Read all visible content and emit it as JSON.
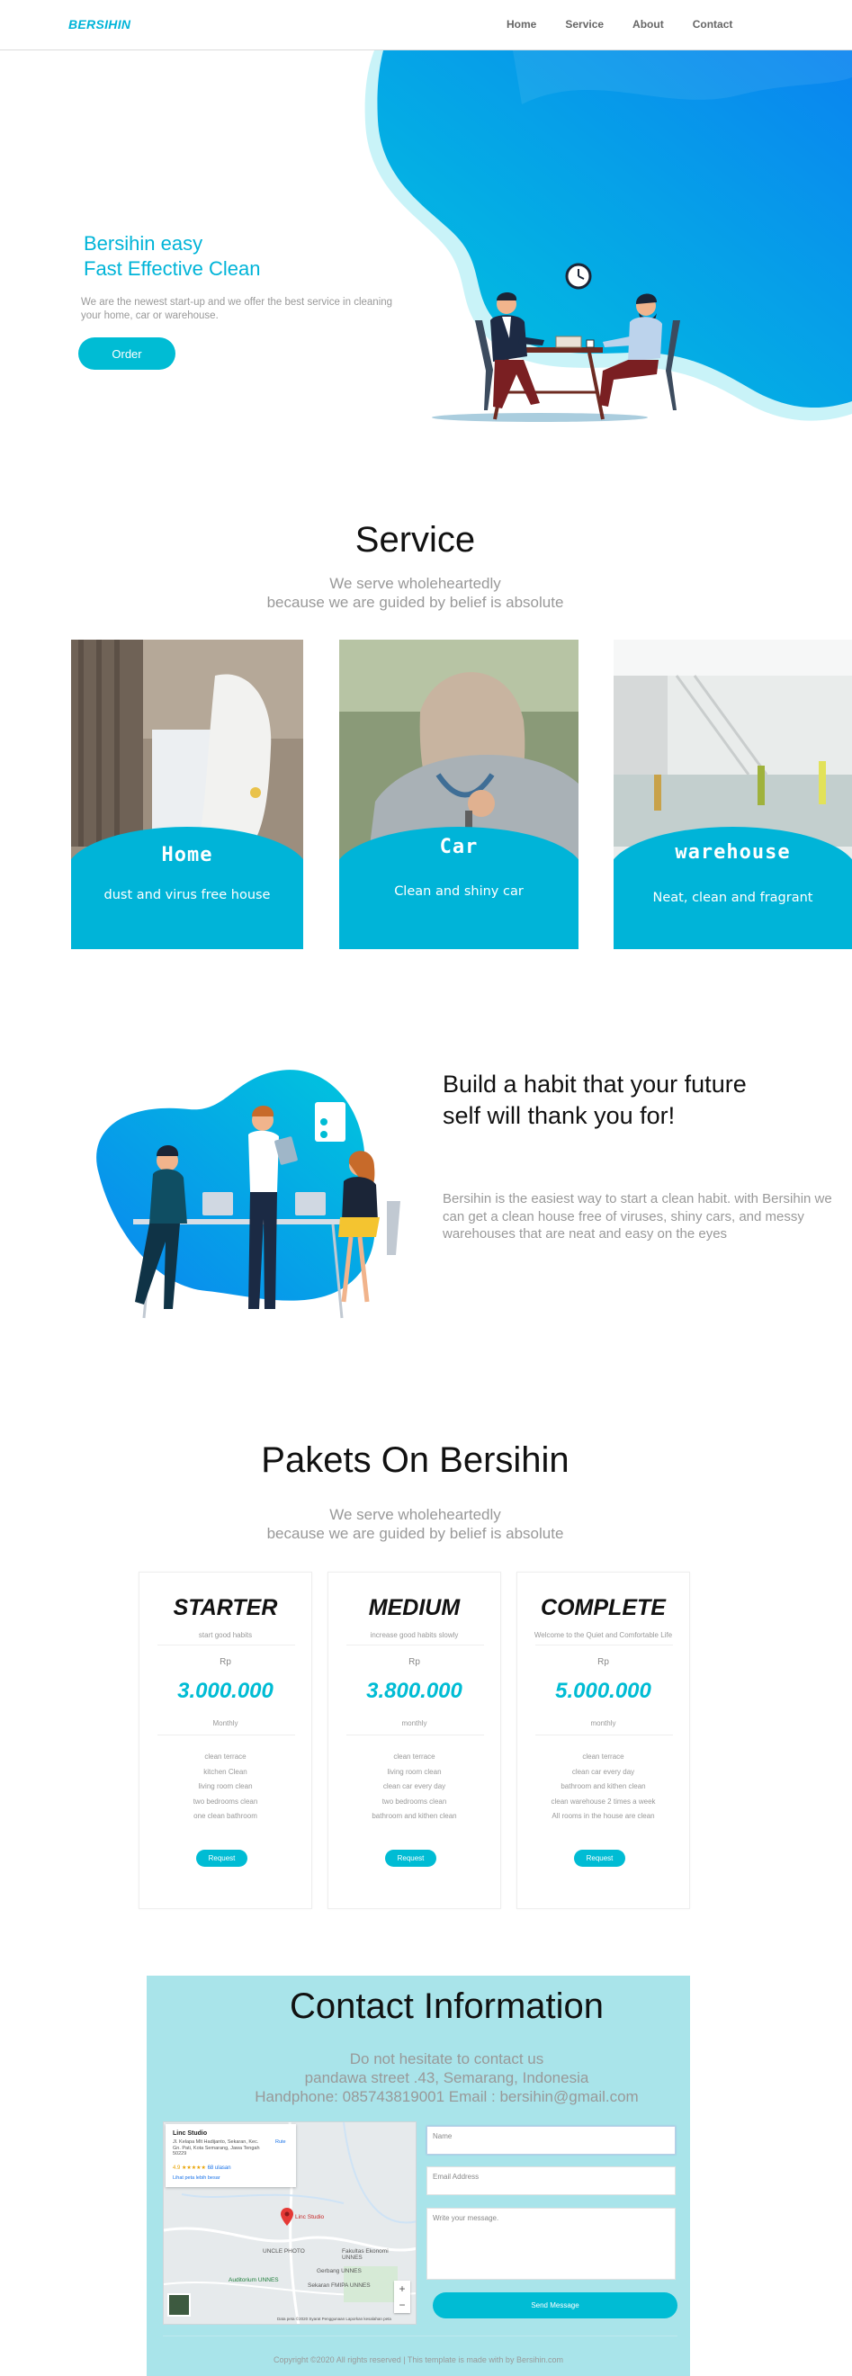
{
  "nav": {
    "brand": "BERSIHIN",
    "links": [
      "Home",
      "Service",
      "About",
      "Contact"
    ]
  },
  "hero": {
    "title_line1": "Bersihin easy",
    "title_line2": "Fast Effective Clean",
    "subtitle": "We are the newest start-up and we offer the best service in cleaning your home, car or warehouse.",
    "order_label": "Order"
  },
  "service": {
    "title": "Service",
    "sub_line1": "We serve wholeheartedly",
    "sub_line2": "because we are guided by belief is absolute",
    "cards": [
      {
        "title": "Home",
        "desc": "dust and virus free house"
      },
      {
        "title": "Car",
        "desc": "Clean and shiny car"
      },
      {
        "title": "warehouse",
        "desc": "Neat, clean and fragrant"
      }
    ]
  },
  "habit": {
    "title": "Build a habit that your future self will thank you for!",
    "text": "Bersihin is the easiest way to start a clean habit. with Bersihin we can get a clean house free of viruses, shiny cars, and messy warehouses that are neat and easy on the eyes"
  },
  "pakets": {
    "title": "Pakets On Bersihin",
    "sub_line1": "We serve wholeheartedly",
    "sub_line2": "because we are guided by belief is absolute",
    "cards": [
      {
        "name": "STARTER",
        "tag": "start good habits",
        "currency": "Rp",
        "price": "3.000.000",
        "period": "Monthly",
        "features": [
          "clean terrace",
          "kitchen Clean",
          "living room clean",
          "two bedrooms clean",
          "one clean bathroom"
        ],
        "button": "Request"
      },
      {
        "name": "MEDIUM",
        "tag": "increase good habits slowly",
        "currency": "Rp",
        "price": "3.800.000",
        "period": "monthly",
        "features": [
          "clean terrace",
          "living room clean",
          "clean car every day",
          "two bedrooms clean",
          "bathroom and kithen clean"
        ],
        "button": "Request"
      },
      {
        "name": "COMPLETE",
        "tag": "Welcome to the Quiet and Comfortable Life",
        "currency": "Rp",
        "price": "5.000.000",
        "period": "monthly",
        "features": [
          "clean terrace",
          "clean car every day",
          "bathroom and kithen clean",
          "clean warehouse 2 times a week",
          "All rooms in the house are clean"
        ],
        "button": "Request"
      }
    ]
  },
  "contact": {
    "title": "Contact Information",
    "line1": "Do not hesitate to contact us",
    "line2": "pandawa street .43, Semarang, Indonesia",
    "line3": "Handphone: 085743819001 Email : bersihin@gmail.com",
    "map": {
      "place": "Linc Studio",
      "address": "Jl. Kelapa Mlt Hadijanto, Sekaran, Kec. Gn. Pati, Kota Semarang, Jawa Tengah 50229",
      "rating": "4.9 ★★★★★",
      "reviews": "68 ulasan",
      "large_map_link": "Lihat peta lebih besar",
      "route": "Rute",
      "labels": [
        "Linc Studio",
        "UNCLE PHOTO",
        "Fakultas Ekonomi UNNES",
        "Auditorium UNNES",
        "Gerbang UNNES",
        "Sekaran FMIPA UNNES"
      ],
      "footer": "Data peta ©2020   Syarat Penggunaan   Laporkan kesalahan peta"
    },
    "name_placeholder": "Name",
    "email_placeholder": "Email Address",
    "message_placeholder": "Write your message.",
    "send_label": "Send Message",
    "copyright": "Copyright ©2020 All rights reserved | This template is made with by Bersihin.com"
  },
  "colors": {
    "accent": "#00bcd4",
    "contact_bg": "#a9e4ea",
    "muted_text": "#999999"
  }
}
